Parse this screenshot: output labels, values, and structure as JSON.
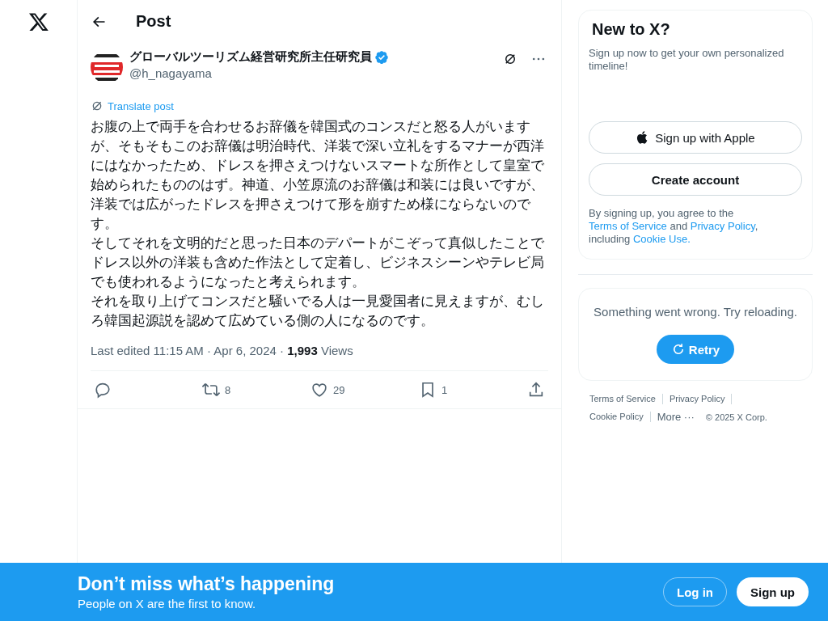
{
  "header": {
    "title": "Post"
  },
  "post": {
    "author": "グローバルツーリズム経営研究所主任研究員",
    "verified": true,
    "handle": "@h_nagayama",
    "translate": "Translate post",
    "paragraphs": [
      "お腹の上で両手を合わせるお辞儀を韓国式のコンスだと怒る人がいますが、そもそもこのお辞儀は明治時代、洋装で深い立礼をするマナーが西洋にはなかったため、ドレスを押さえつけないスマートな所作として皇室で始められたもののはず。神道、小笠原流のお辞儀は和装には良いですが、洋装では広がったドレスを押さえつけて形を崩すため様にならないのです。",
      "そしてそれを文明的だと思った日本のデパートがこぞって真似したことでドレス以外の洋装も含めた作法として定着し、ビジネスシーンやテレビ局でも使われるようになったと考えられます。",
      "それを取り上げてコンスだと騒いでる人は一見愛国者に見えますが、むしろ韓国起源説を認めて広めている側の人になるのです。"
    ],
    "meta": "Last edited 11:15 AM · Apr 6, 2024 · **1,993** Views",
    "actions": [
      {
        "kind": "reply"
      },
      {
        "kind": "repost",
        "count": "8"
      },
      {
        "kind": "like",
        "count": "29"
      },
      {
        "kind": "bookmark",
        "count": "1"
      },
      {
        "kind": "share"
      }
    ]
  },
  "signup": {
    "title": "New to X?",
    "subtitle": "Sign up now to get your own personalized timeline!",
    "apple": "Sign up with Apple",
    "create": "Create account",
    "legal": [
      {
        "text": "By signing up, you agree to the ",
        "kind": "text"
      },
      {
        "text": "Terms of Service",
        "kind": "link"
      },
      {
        "text": " and ",
        "kind": "text"
      },
      {
        "text": "Privacy Policy",
        "kind": "link"
      },
      {
        "text": ", including ",
        "kind": "text"
      },
      {
        "text": "Cookie Use.",
        "kind": "link"
      }
    ]
  },
  "error": {
    "message": "Something went wrong. Try reloading.",
    "retry": "Retry"
  },
  "footer": {
    "links": [
      "Terms of Service",
      "Privacy Policy",
      "Cookie Policy"
    ],
    "more": "More ···",
    "copyright": "© 2025 X Corp."
  },
  "banner": {
    "title": "Don’t miss what’s happening",
    "subtitle": "People on X are the first to know.",
    "login": "Log in",
    "signup": "Sign up"
  }
}
